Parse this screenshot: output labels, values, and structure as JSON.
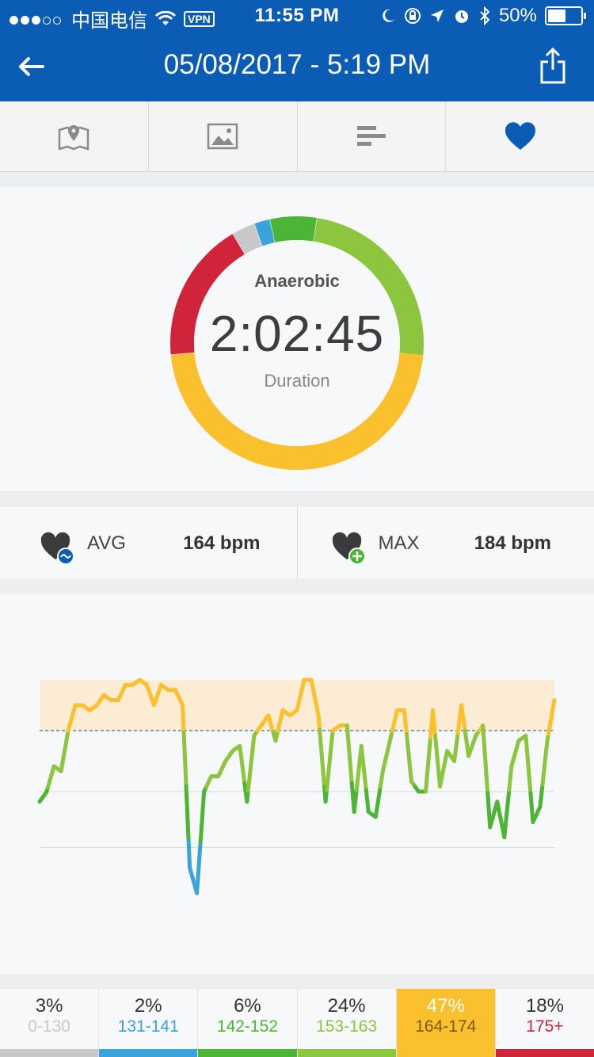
{
  "status_bar": {
    "carrier": "中国电信",
    "vpn": "VPN",
    "time": "11:55 PM",
    "battery": "50%"
  },
  "nav": {
    "title": "05/08/2017 - 5:19 PM",
    "back_icon": "back-arrow-icon",
    "share_icon": "share-icon"
  },
  "tabs": [
    {
      "icon": "map-icon",
      "active": false
    },
    {
      "icon": "image-icon",
      "active": false
    },
    {
      "icon": "bars-icon",
      "active": false
    },
    {
      "icon": "heart-icon",
      "active": true
    }
  ],
  "summary": {
    "zone_name": "Anaerobic",
    "duration": "2:02:45",
    "duration_label": "Duration"
  },
  "stats": {
    "avg_label": "AVG",
    "avg_value": "164 bpm",
    "max_label": "MAX",
    "max_value": "184 bpm"
  },
  "zones": [
    {
      "pct": "3%",
      "range": "0-130",
      "color": "#c8c8c8",
      "share": 0.03
    },
    {
      "pct": "2%",
      "range": "131-141",
      "color": "#3aa3dc",
      "share": 0.02
    },
    {
      "pct": "6%",
      "range": "142-152",
      "color": "#4db535",
      "share": 0.06
    },
    {
      "pct": "24%",
      "range": "153-163",
      "color": "#8cc63e",
      "share": 0.24
    },
    {
      "pct": "47%",
      "range": "164-174",
      "color": "#fbc02d",
      "share": 0.47,
      "selected": true
    },
    {
      "pct": "18%",
      "range": "175+",
      "color": "#d0243a",
      "share": 0.18
    }
  ],
  "chart_data": {
    "type": "line",
    "series": [
      {
        "values": [
          150,
          152,
          157,
          156,
          164,
          169,
          169,
          168,
          169,
          171,
          170,
          170,
          173,
          173,
          174,
          173,
          169,
          173,
          172,
          172,
          169,
          137,
          132,
          152,
          155,
          155,
          158,
          160,
          161,
          150,
          163,
          165,
          167,
          162,
          168,
          167,
          168,
          174,
          174,
          167,
          150,
          164,
          165,
          165,
          148,
          161,
          148,
          147,
          156,
          162,
          168,
          168,
          154,
          152,
          152,
          168,
          153,
          160,
          158,
          169,
          159,
          163,
          165,
          145,
          150,
          143,
          157,
          162,
          163,
          146,
          149,
          162,
          170
        ]
      }
    ],
    "ylim": [
      130,
      184
    ],
    "average": 164,
    "band": [
      164,
      174
    ]
  }
}
